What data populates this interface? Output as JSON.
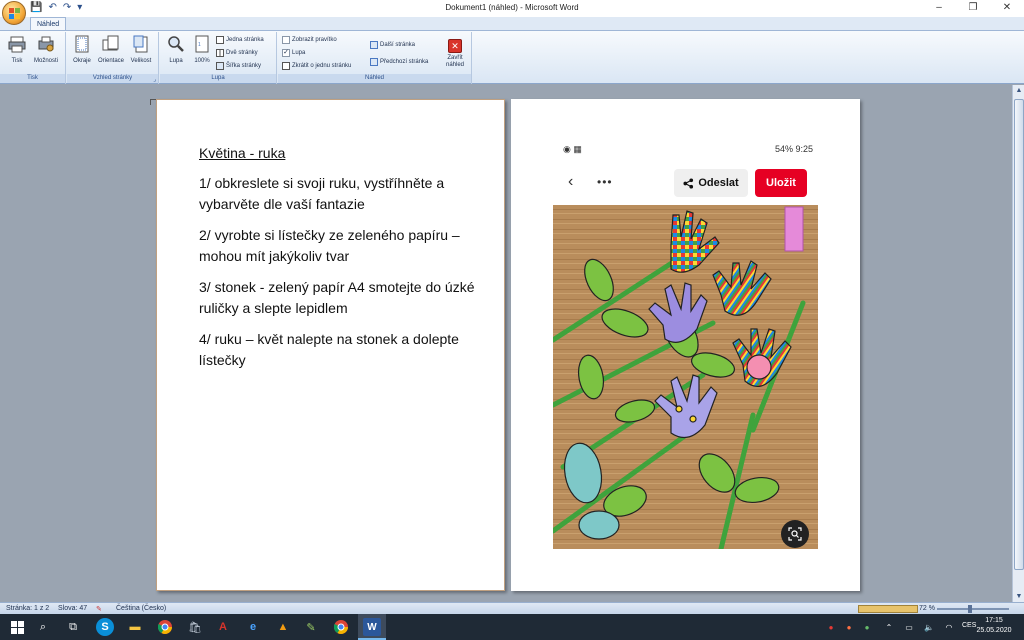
{
  "window": {
    "title": "Dokument1 (náhled) - Microsoft Word",
    "minimize": "–",
    "restore": "❐",
    "close": "✕"
  },
  "quick_access": {
    "save": "💾",
    "undo": "↶",
    "redo": "↷",
    "customize": "▾"
  },
  "ribbon": {
    "active_tab": "Náhled",
    "groups": {
      "tisk": {
        "label": "Tisk",
        "print": "Tisk",
        "options": "Možnosti"
      },
      "vzhled": {
        "label": "Vzhled stránky",
        "margins": "Okraje",
        "orientation": "Orientace",
        "size": "Velikost"
      },
      "lupa": {
        "label": "Lupa",
        "zoom": "Lupa",
        "zoom100": "100%",
        "one_page": "Jedna stránka",
        "two_pages": "Dvě stránky",
        "page_width": "Šířka stránky"
      },
      "nahled": {
        "label": "Náhled",
        "show_ruler": "Zobrazit pravítko",
        "magnifier": "Lupa",
        "shrink": "Zkrátit o jednu stránku",
        "next_page": "Další stránka",
        "prev_page": "Předchozí stránka",
        "close_1": "Zavřít",
        "close_2": "náhled"
      }
    }
  },
  "document": {
    "heading": "Květina  - ruka",
    "steps": [
      "1/ obkreslete si svoji ruku, vystříhněte a vybarvěte dle vaší fantazie",
      "2/ vyrobte si lístečky ze zeleného papíru – mohou mít jakýkoliv tvar",
      "3/ stonek - zelený papír A4 smotejte do úzké ruličky a slepte lepidlem",
      "4/ ruku – květ nalepte na stonek a dolepte lístečky"
    ]
  },
  "phone": {
    "status_right": "54% 9:25",
    "status_left": "◉ ▦",
    "share_label": "Odeslat",
    "save_label": "Uložit",
    "more": "•••",
    "back": "‹"
  },
  "statusbar": {
    "page": "Stránka: 1 z 2",
    "words": "Slova: 47",
    "language": "Čeština (Česko)",
    "zoom": "72 %"
  },
  "taskbar": {
    "lang": "CES",
    "time": "17:15",
    "date": "25.05.2020"
  },
  "colors": {
    "accent_red": "#e60023",
    "ribbon_blue": "#2b4f8a"
  }
}
